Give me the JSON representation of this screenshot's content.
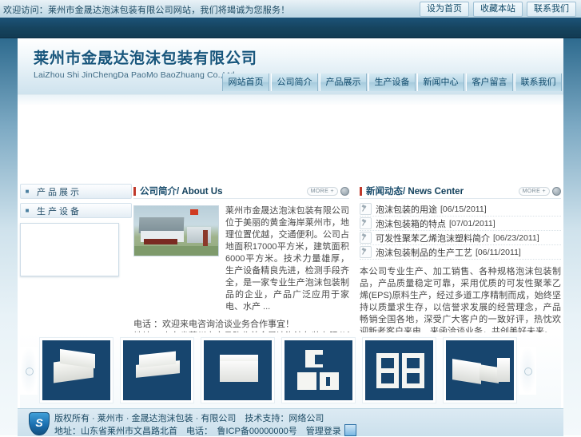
{
  "topbar": {
    "welcome": "欢迎访问：莱州市金晟达泡沫包装有限公司网站，我们将竭诚为您服务！",
    "links": [
      {
        "label": "设为首页",
        "name": "set-homepage"
      },
      {
        "label": "收藏本站",
        "name": "add-favorite"
      },
      {
        "label": "联系我们",
        "name": "contact-us"
      }
    ]
  },
  "header": {
    "logo_cn": "莱州市金晟达泡沫包装有限公司",
    "logo_en": "LaiZhou Shi JinChengDa PaoMo BaoZhuang Co.,Ltd.",
    "nav": [
      {
        "label": "网站首页",
        "name": "home"
      },
      {
        "label": "公司简介",
        "name": "about"
      },
      {
        "label": "产品展示",
        "name": "products"
      },
      {
        "label": "生产设备",
        "name": "equipment"
      },
      {
        "label": "新闻中心",
        "name": "news"
      },
      {
        "label": "客户留言",
        "name": "guestbook"
      },
      {
        "label": "联系我们",
        "name": "contact"
      }
    ]
  },
  "sidebar": {
    "items": [
      {
        "label": "产品展示"
      },
      {
        "label": "生产设备"
      }
    ]
  },
  "about": {
    "title_cn": "公司简介",
    "title_sep": "/ ",
    "title_en": "About Us",
    "more": "MORE +",
    "text": "莱州市金晟达泡沫包装有限公司位于美丽的黄金海岸莱州市，地理位置优越，交通便利。公司占地面积17000平方米，建筑面积6000平方米。技术力量雄厚，生产设备精良先进，检测手段齐全，是一家专业生产泡沫包装制品的企业，产品广泛应用于家电、水产 ...",
    "contact_lines": [
      "电话 ：欢迎来电咨询洽谈业务合作事宜！",
      "地址 ：山东省莱州市文昌路北首金晟达泡沫包装有限公司办公楼"
    ]
  },
  "news": {
    "title_cn": "新闻动态",
    "title_sep": "/ ",
    "title_en": "News Center",
    "more": "MORE +",
    "items": [
      {
        "title": "泡沫包装的用途",
        "date": "[06/15/2011]"
      },
      {
        "title": "泡沫包装箱的特点",
        "date": "[07/01/2011]"
      },
      {
        "title": "可发性聚苯乙烯泡沫塑料简介",
        "date": "[06/23/2011]"
      },
      {
        "title": "泡沫包装制品的生产工艺",
        "date": "[06/11/2011]"
      }
    ],
    "description": "本公司专业生产、加工销售、各种规格泡沫包装制品，产品质量稳定可靠，采用优质的可发性聚苯乙烯(EPS)原料生产，经过多道工序精制而成，始终坚持以质量求生存，以信誉求发展的经营理念，产品畅销全国各地，深受广大客户的一致好评，热忱欢迎新老客户来电、来函洽谈业务，共创美好未来。"
  },
  "products": {
    "prev_label": "‹",
    "next_label": "›",
    "items": [
      {
        "alt": "泡沫包装箱1"
      },
      {
        "alt": "泡沫包装箱2"
      },
      {
        "alt": "泡沫保温箱"
      },
      {
        "alt": "泡沫异型件"
      },
      {
        "alt": "泡沫模具件"
      },
      {
        "alt": "泡沫包装组合"
      }
    ]
  },
  "footer": {
    "line1": "版权所有 · 莱州市 · 金晟达泡沫包装 · 有限公司　技术支持：网络公司",
    "line2": "地址：山东省莱州市文昌路北首　电话：　鲁ICP备00000000号　管理登录",
    "badge": "网监"
  },
  "colors": {
    "navy": "#16445f",
    "accent_red": "#c0392b",
    "product_bg": "#17456e",
    "link_blue": "#1d4f6e"
  }
}
